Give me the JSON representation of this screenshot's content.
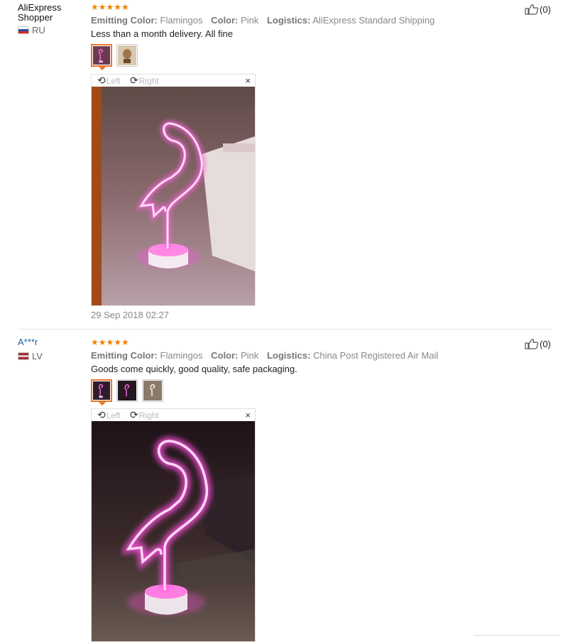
{
  "reviews": [
    {
      "user": "AliExpress Shopper",
      "country": "RU",
      "stars": "★★★★★",
      "attrs": [
        {
          "label": "Emitting Color:",
          "value": "Flamingos"
        },
        {
          "label": "Color:",
          "value": "Pink"
        },
        {
          "label": "Logistics:",
          "value": "AliExpress Standard Shipping"
        }
      ],
      "text": "Less than a month delivery. All fine",
      "viewer": {
        "left": "Left",
        "right": "Right",
        "close": "×"
      },
      "date": "29 Sep 2018 02:27",
      "likes": "(0)"
    },
    {
      "user": "A***r",
      "country": "LV",
      "stars": "★★★★★",
      "attrs": [
        {
          "label": "Emitting Color:",
          "value": "Flamingos"
        },
        {
          "label": "Color:",
          "value": "Pink"
        },
        {
          "label": "Logistics:",
          "value": "China Post Registered Air Mail"
        }
      ],
      "text": "Goods come quickly, good quality, safe packaging.",
      "viewer": {
        "left": "Left",
        "right": "Right",
        "close": "×"
      },
      "likes": "(0)"
    }
  ],
  "colors": {
    "stars": "#f08200",
    "active_thumb": "#e8782d",
    "neon": "#ff4fd8"
  }
}
